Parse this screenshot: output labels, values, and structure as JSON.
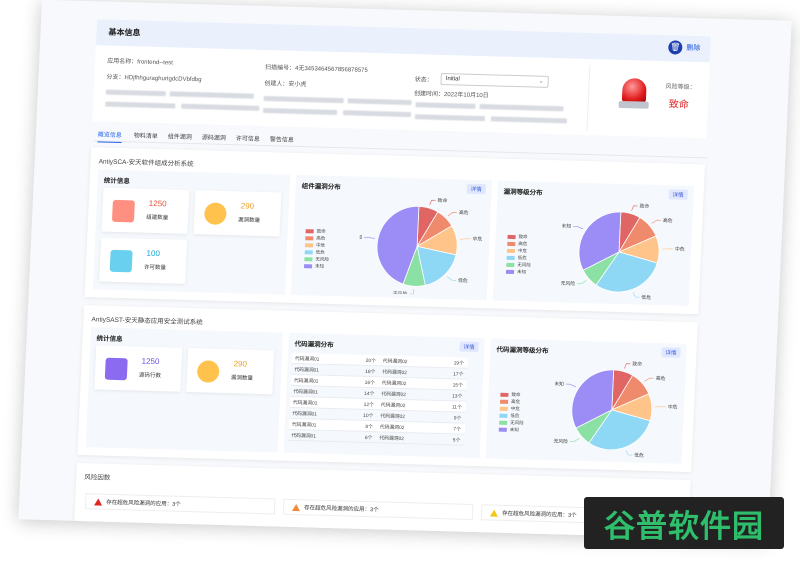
{
  "header": {
    "title": "基本信息",
    "delete_label": "删除"
  },
  "info": {
    "app_name_label": "应用名称：",
    "app_name": "frontend--test",
    "scan_no_label": "扫描编号：",
    "scan_no": "4无3453464567856878575",
    "status_label": "状态：",
    "status_value": "Initial",
    "branch_label": "分支：",
    "branch": "HDjfhhguraghurtgdcDVbfdbg",
    "creator_label": "创建人：",
    "creator": "安小虎",
    "created_label": "创建时间：",
    "created": "2022年10月10日",
    "risk_label": "风险等级：",
    "risk_value": "致命"
  },
  "tabs": [
    "概览信息",
    "物料清单",
    "组件漏洞",
    "源码漏洞",
    "许可信息",
    "警告信息"
  ],
  "sca": {
    "title": "AntiySCA-安天软件组成分析系统",
    "stats_title": "统计信息",
    "cards": [
      {
        "value": "1250",
        "caption": "组建数量"
      },
      {
        "value": "290",
        "caption": "漏洞数量"
      },
      {
        "value": "100",
        "caption": "许可数量"
      }
    ],
    "chart1_title": "组件漏洞分布",
    "chart2_title": "漏洞等级分布",
    "detail_label": "详情"
  },
  "sast": {
    "title": "AntiySAST-安天静态应用安全测试系统",
    "stats_title": "统计信息",
    "cards": [
      {
        "value": "1250",
        "caption": "源码行数"
      },
      {
        "value": "290",
        "caption": "漏洞数量"
      }
    ],
    "table_title": "代码漏洞分布",
    "chart_title": "代码漏洞等级分布",
    "detail_label": "详情",
    "rows": [
      [
        "代码漏洞01",
        "20个",
        "代码漏洞02",
        "19个"
      ],
      [
        "代码漏洞01",
        "18个",
        "代码漏洞02",
        "17个"
      ],
      [
        "代码漏洞01",
        "16个",
        "代码漏洞02",
        "15个"
      ],
      [
        "代码漏洞01",
        "14个",
        "代码漏洞02",
        "13个"
      ],
      [
        "代码漏洞01",
        "12个",
        "代码漏洞02",
        "11个"
      ],
      [
        "代码漏洞01",
        "10个",
        "代码漏洞02",
        "9个"
      ],
      [
        "代码漏洞01",
        "8个",
        "代码漏洞02",
        "7个"
      ],
      [
        "代码漏洞01",
        "6个",
        "代码漏洞02",
        "5个"
      ]
    ]
  },
  "risk": {
    "title": "风险因数",
    "items": [
      "存在超危风险漏洞的应用：3个",
      "存在超危风险漏洞的应用：3个",
      "存在超危风险漏洞的应用：3个"
    ]
  },
  "levels": [
    "致命",
    "高危",
    "中危",
    "低危",
    "无风险",
    "未知"
  ],
  "colors": {
    "accent": "#2563eb",
    "danger": "#e02424",
    "fatal": "#e06666",
    "high": "#f08a6c",
    "mid": "#ffc48a",
    "low": "#8fd8f5",
    "none": "#8be0a4",
    "unknown": "#9b8df5"
  },
  "chart_data": [
    {
      "type": "pie",
      "title": "组件漏洞分布",
      "categories": [
        "致命",
        "高危",
        "中危",
        "低危",
        "无风险",
        "未知"
      ],
      "values": [
        8,
        8,
        12,
        18,
        9,
        45
      ]
    },
    {
      "type": "pie",
      "title": "漏洞等级分布",
      "categories": [
        "致命",
        "高危",
        "中危",
        "低危",
        "无风险",
        "未知"
      ],
      "values": [
        8,
        10,
        11,
        30,
        8,
        33
      ]
    },
    {
      "type": "pie",
      "title": "代码漏洞等级分布",
      "categories": [
        "致命",
        "高危",
        "中危",
        "低危",
        "无风险",
        "未知"
      ],
      "values": [
        8,
        10,
        11,
        30,
        8,
        33
      ]
    }
  ],
  "watermark": "谷普软件园"
}
